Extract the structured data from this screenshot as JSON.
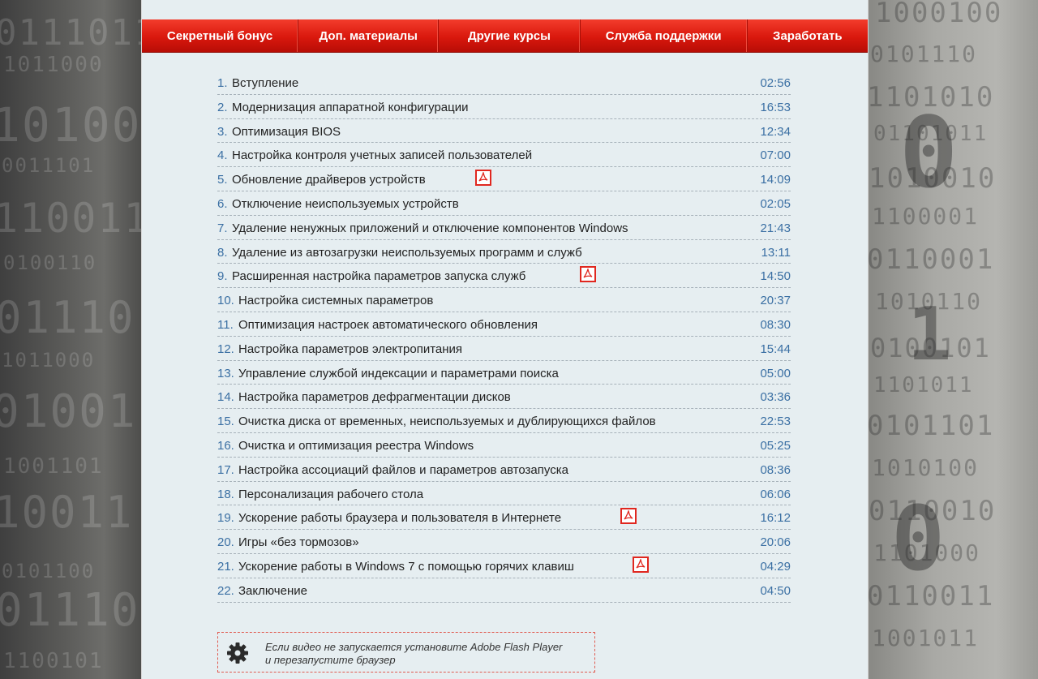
{
  "nav": {
    "items": [
      {
        "label": "Секретный бонус"
      },
      {
        "label": "Доп. материалы"
      },
      {
        "label": "Другие курсы"
      },
      {
        "label": "Служба поддержки"
      },
      {
        "label": "Заработать"
      }
    ]
  },
  "lessons": [
    {
      "num": "1.",
      "title": "Вступление",
      "time": "02:56",
      "pdf": false
    },
    {
      "num": "2.",
      "title": "Модернизация аппаратной конфигурации",
      "time": "16:53",
      "pdf": false
    },
    {
      "num": "3.",
      "title": "Оптимизация BIOS",
      "time": "12:34",
      "pdf": false
    },
    {
      "num": "4.",
      "title": "Настройка контроля учетных записей пользователей",
      "time": "07:00",
      "pdf": false
    },
    {
      "num": "5.",
      "title": "Обновление драйверов устройств",
      "time": "14:09",
      "pdf": true
    },
    {
      "num": "6.",
      "title": "Отключение неиспользуемых устройств",
      "time": "02:05",
      "pdf": false
    },
    {
      "num": "7.",
      "title": "Удаление ненужных приложений и отключение компонентов Windows",
      "time": "21:43",
      "pdf": false
    },
    {
      "num": "8.",
      "title": "Удаление из автозагрузки неиспользуемых программ и служб",
      "time": "13:11",
      "pdf": false
    },
    {
      "num": "9.",
      "title": "Расширенная настройка параметров запуска служб",
      "time": "14:50",
      "pdf": true
    },
    {
      "num": "10.",
      "title": "Настройка системных параметров",
      "time": "20:37",
      "pdf": false
    },
    {
      "num": "11.",
      "title": "Оптимизация настроек автоматического обновления",
      "time": "08:30",
      "pdf": false
    },
    {
      "num": "12.",
      "title": "Настройка параметров электропитания",
      "time": "15:44",
      "pdf": false
    },
    {
      "num": "13.",
      "title": "Управление службой индексации и параметрами поиска",
      "time": "05:00",
      "pdf": false
    },
    {
      "num": "14.",
      "title": "Настройка параметров дефрагментации дисков",
      "time": "03:36",
      "pdf": false
    },
    {
      "num": "15.",
      "title": "Очистка диска от временных, неиспользуемых и дублирующихся файлов",
      "time": "22:53",
      "pdf": false
    },
    {
      "num": "16.",
      "title": "Очистка и оптимизация реестра Windows",
      "time": "05:25",
      "pdf": false
    },
    {
      "num": "17.",
      "title": "Настройка ассоциаций файлов и параметров автозапуска",
      "time": "08:36",
      "pdf": false
    },
    {
      "num": "18.",
      "title": "Персонализация рабочего стола",
      "time": "06:06",
      "pdf": false
    },
    {
      "num": "19.",
      "title": "Ускорение работы браузера и пользователя в Интернете",
      "time": "16:12",
      "pdf": true
    },
    {
      "num": "20.",
      "title": "Игры «без тормозов»",
      "time": "20:06",
      "pdf": false
    },
    {
      "num": "21.",
      "title": "Ускорение работы в Windows 7 с помощью горячих клавиш",
      "time": "04:29",
      "pdf": true
    },
    {
      "num": "22.",
      "title": "Заключение",
      "time": "04:50",
      "pdf": false
    }
  ],
  "notice": {
    "line1": "Если видео не запускается установите Adobe Flash Player",
    "line2": "и перезапустите браузер"
  },
  "icons": {
    "pdf": "pdf-icon",
    "gear": "gear-icon"
  },
  "colors": {
    "nav_red": "#d9180d",
    "accent_blue": "#3a6fa3",
    "pdf_red": "#e0271f"
  }
}
